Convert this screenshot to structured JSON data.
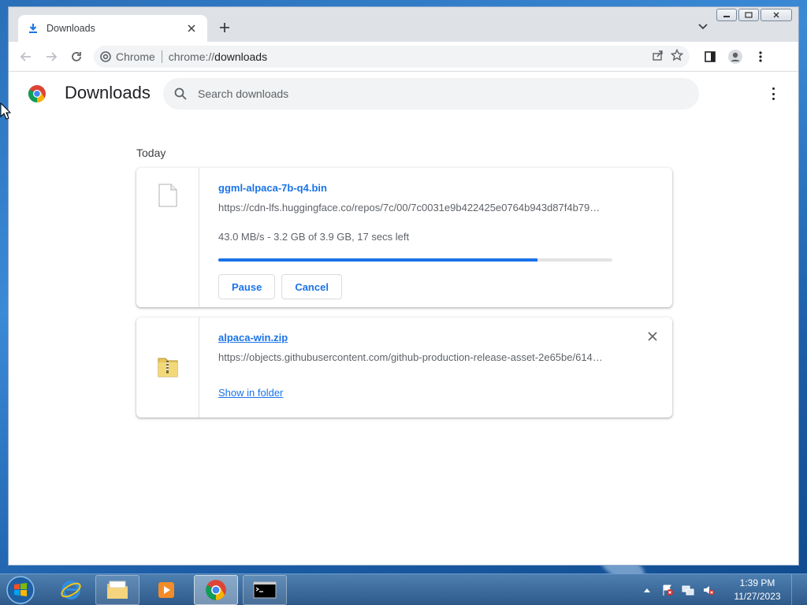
{
  "browser": {
    "tab_title": "Downloads",
    "omnibox_chip": "Chrome",
    "url_scheme": "chrome://",
    "url_host": "downloads"
  },
  "page": {
    "title": "Downloads",
    "search_placeholder": "Search downloads",
    "section": "Today"
  },
  "downloads": [
    {
      "file_name": "ggml-alpaca-7b-q4.bin",
      "url": "https://cdn-lfs.huggingface.co/repos/7c/00/7c0031e9b422425e0764b943d87f4b79…",
      "status": "43.0 MB/s - 3.2 GB of 3.9 GB, 17 secs left",
      "progress": 0.81,
      "pause_label": "Pause",
      "cancel_label": "Cancel"
    },
    {
      "file_name": "alpaca-win.zip",
      "url": "https://objects.githubusercontent.com/github-production-release-asset-2e65be/614…",
      "show_in_folder_label": "Show in folder"
    }
  ],
  "taskbar": {
    "time": "1:39 PM",
    "date": "11/27/2023"
  },
  "colors": {
    "accent": "#1a73e8",
    "progress_track": "#e3e3e3"
  }
}
